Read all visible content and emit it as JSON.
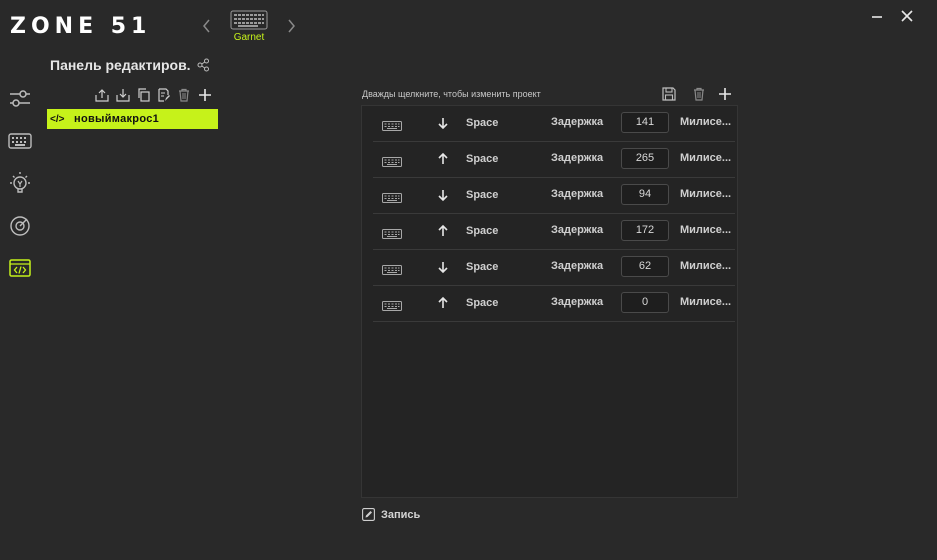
{
  "header": {
    "logo": "ZONE 51",
    "device_name": "Garnet",
    "accent": "#c6f21a"
  },
  "sidebar": {
    "items": [
      {
        "name": "settings",
        "icon": "sliders-icon"
      },
      {
        "name": "keyboard",
        "icon": "keyboard-icon"
      },
      {
        "name": "lighting",
        "icon": "bulb-icon"
      },
      {
        "name": "performance",
        "icon": "gauge-icon"
      },
      {
        "name": "macro",
        "icon": "code-window-icon",
        "active": true
      }
    ]
  },
  "panel": {
    "title": "Панель редактиров.",
    "macros": [
      {
        "name": "новыймакрос1",
        "code_glyph": "</>"
      }
    ]
  },
  "editor": {
    "hint": "Дважды щелкните, чтобы изменить проект",
    "delay_label": "Задержка",
    "unit_label": "Милисе...",
    "events": [
      {
        "direction": "down",
        "key": "Space",
        "delay": "141"
      },
      {
        "direction": "up",
        "key": "Space",
        "delay": "265"
      },
      {
        "direction": "down",
        "key": "Space",
        "delay": "94"
      },
      {
        "direction": "up",
        "key": "Space",
        "delay": "172"
      },
      {
        "direction": "down",
        "key": "Space",
        "delay": "62"
      },
      {
        "direction": "up",
        "key": "Space",
        "delay": "0"
      }
    ],
    "record_label": "Запись"
  }
}
